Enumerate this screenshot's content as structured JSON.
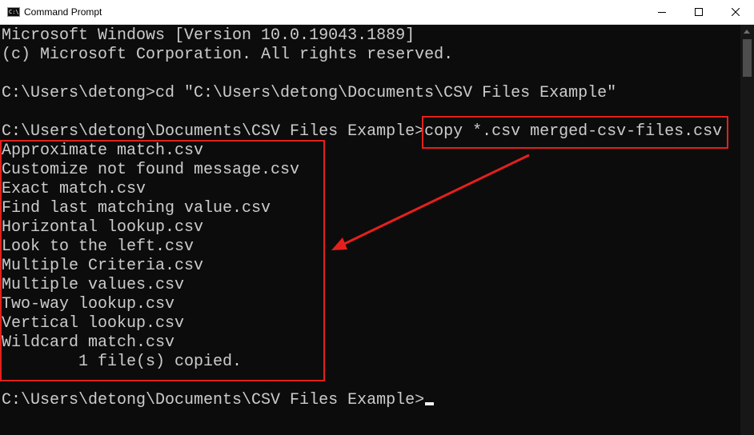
{
  "window": {
    "title": "Command Prompt",
    "icon_label": "C:\\"
  },
  "console": {
    "lines": [
      "Microsoft Windows [Version 10.0.19043.1889]",
      "(c) Microsoft Corporation. All rights reserved.",
      "",
      "C:\\Users\\detong>cd \"C:\\Users\\detong\\Documents\\CSV Files Example\"",
      "",
      "C:\\Users\\detong\\Documents\\CSV Files Example>copy *.csv merged-csv-files.csv",
      "Approximate match.csv",
      "Customize not found message.csv",
      "Exact match.csv",
      "Find last matching value.csv",
      "Horizontal lookup.csv",
      "Look to the left.csv",
      "Multiple Criteria.csv",
      "Multiple values.csv",
      "Two-way lookup.csv",
      "Vertical lookup.csv",
      "Wildcard match.csv",
      "        1 file(s) copied.",
      "",
      "C:\\Users\\detong\\Documents\\CSV Files Example>"
    ]
  },
  "icons": {
    "minimize": "minimize-icon",
    "maximize": "maximize-icon",
    "close": "close-icon",
    "app": "command-prompt-icon"
  },
  "colors": {
    "console_background": "#0c0c0c",
    "console_text": "#cccccc",
    "annotation": "#e5201c"
  }
}
